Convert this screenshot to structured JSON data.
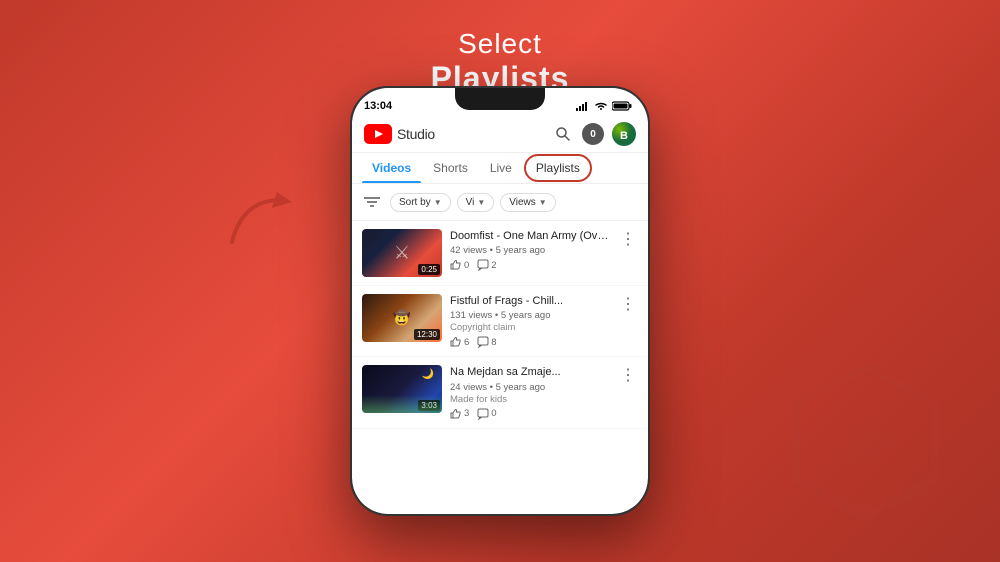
{
  "page": {
    "background": "gradient-red",
    "title": {
      "line1": "Select",
      "line2": "Playlists"
    }
  },
  "status_bar": {
    "time": "13:04",
    "icons": [
      "signal",
      "wifi",
      "battery"
    ]
  },
  "header": {
    "logo_text": "Studio",
    "avatar_letter": "0"
  },
  "tabs": [
    {
      "label": "Videos",
      "active": true
    },
    {
      "label": "Shorts",
      "active": false
    },
    {
      "label": "Live",
      "active": false
    },
    {
      "label": "Playlists",
      "active": false,
      "highlighted": true
    }
  ],
  "filter_bar": {
    "sort_label": "Sort by",
    "view_label": "Vi",
    "views_label": "Views"
  },
  "videos": [
    {
      "title": "Doomfist - One Man Army (Overwatch)",
      "meta": "42 views • 5 years ago",
      "status": "",
      "duration": "0:25",
      "likes": "0",
      "comments": "2",
      "thumb_class": "thumb-1"
    },
    {
      "title": "Fistful of Frags - Chill...",
      "meta": "131 views • 5 years ago",
      "status": "Copyright claim",
      "duration": "12:30",
      "likes": "6",
      "comments": "8",
      "thumb_class": "thumb-2"
    },
    {
      "title": "Na Mejdan sa Zmaje...",
      "meta": "24 views • 5 years ago",
      "status": "Made for kids",
      "duration": "3:03",
      "likes": "3",
      "comments": "0",
      "thumb_class": "thumb-3"
    }
  ]
}
